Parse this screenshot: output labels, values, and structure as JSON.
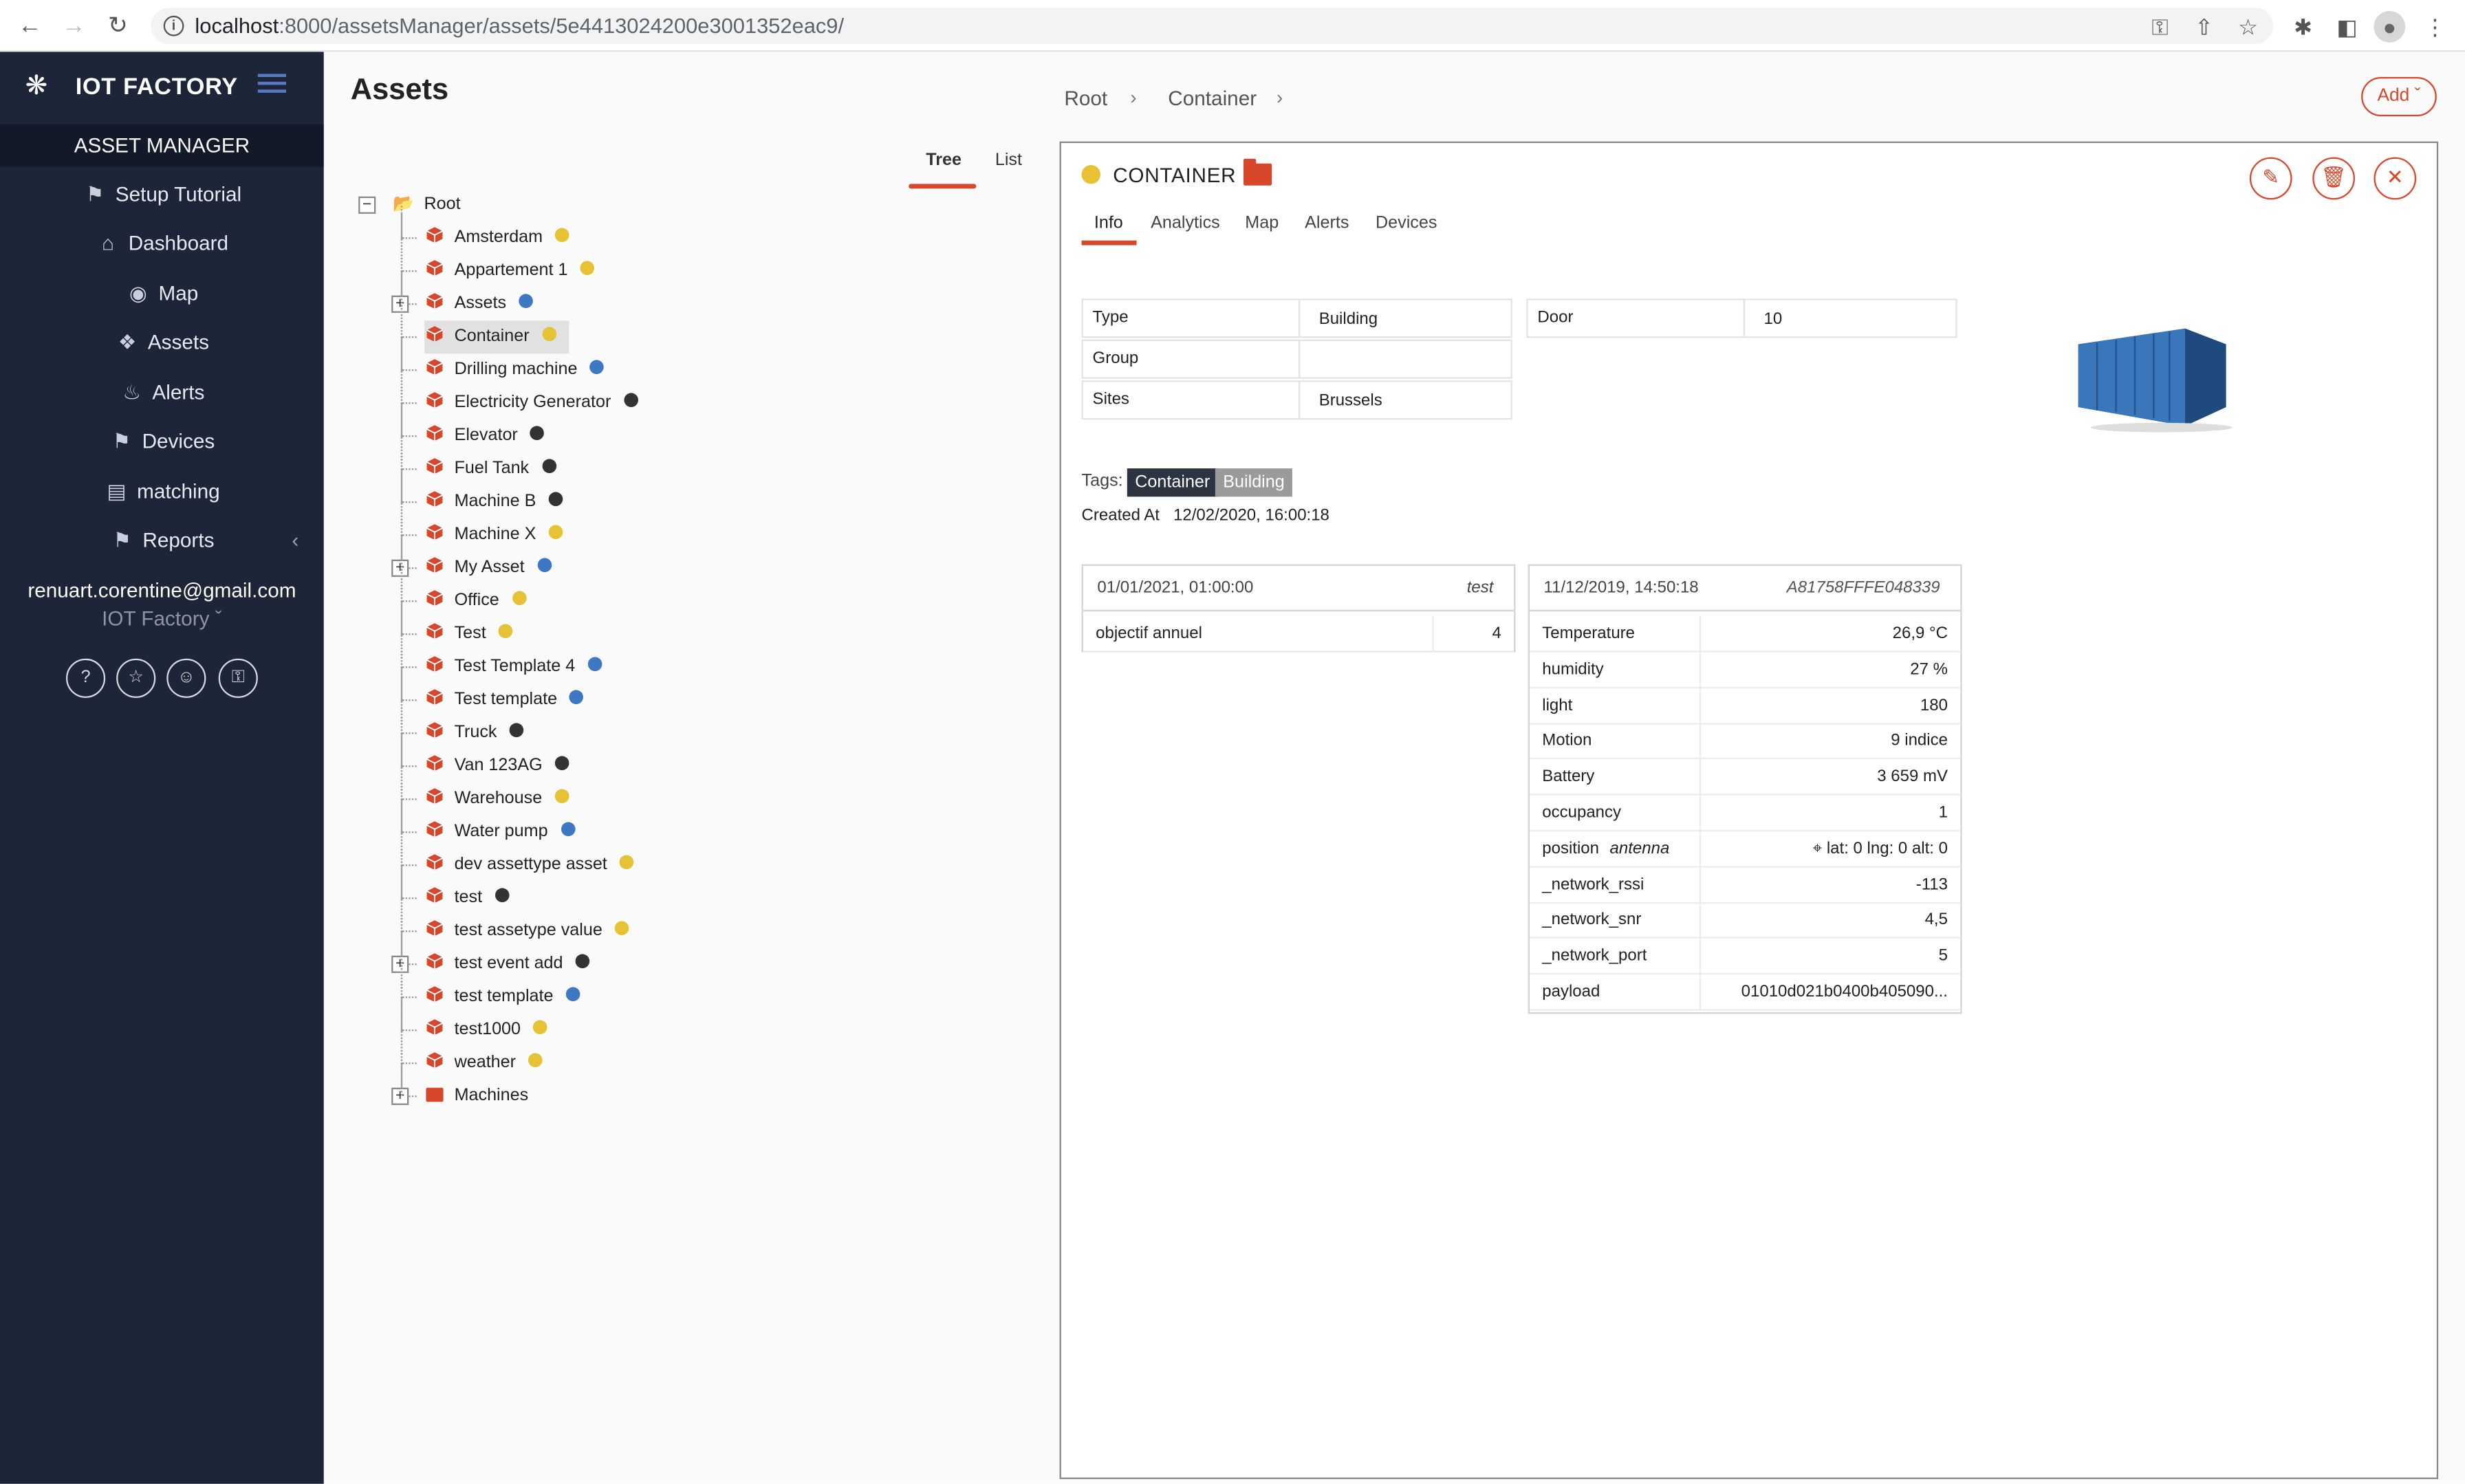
{
  "browser": {
    "url_host": "localhost",
    "url_path": ":8000/assetsManager/assets/5e4413024200e3001352eac9/"
  },
  "sidebar": {
    "brand": "IOT FACTORY",
    "section": "ASSET MANAGER",
    "items": [
      {
        "label": "Setup Tutorial",
        "icon": "tag-icon"
      },
      {
        "label": "Dashboard",
        "icon": "home-icon"
      },
      {
        "label": "Map",
        "icon": "pin-icon"
      },
      {
        "label": "Assets",
        "icon": "boxes-icon"
      },
      {
        "label": "Alerts",
        "icon": "bell-icon"
      },
      {
        "label": "Devices",
        "icon": "tag-icon"
      },
      {
        "label": "matching",
        "icon": "briefcase-icon"
      },
      {
        "label": "Reports",
        "icon": "tag-icon"
      }
    ],
    "user_email": "renuart.corentine@gmail.com",
    "org": "IOT Factory"
  },
  "header": {
    "title": "Assets",
    "breadcrumb": [
      "Root",
      "Container"
    ],
    "add_label": "Add"
  },
  "view_tabs": [
    "Tree",
    "List"
  ],
  "tree": {
    "root": "Root",
    "items": [
      {
        "label": "Amsterdam",
        "color": "#e6c234",
        "expand": false
      },
      {
        "label": "Appartement 1",
        "color": "#e6c234",
        "expand": false
      },
      {
        "label": "Assets",
        "color": "#3e78c2",
        "expand": true
      },
      {
        "label": "Container",
        "color": "#e6c234",
        "expand": false,
        "selected": true
      },
      {
        "label": "Drilling machine",
        "color": "#3e78c2",
        "expand": false
      },
      {
        "label": "Electricity Generator",
        "color": "#333333",
        "expand": false
      },
      {
        "label": "Elevator",
        "color": "#333333",
        "expand": false
      },
      {
        "label": "Fuel Tank",
        "color": "#333333",
        "expand": false
      },
      {
        "label": "Machine B",
        "color": "#333333",
        "expand": false
      },
      {
        "label": "Machine X",
        "color": "#e6c234",
        "expand": false
      },
      {
        "label": "My Asset",
        "color": "#3e78c2",
        "expand": true
      },
      {
        "label": "Office",
        "color": "#e6c234",
        "expand": false
      },
      {
        "label": "Test",
        "color": "#e6c234",
        "expand": false
      },
      {
        "label": "Test Template 4",
        "color": "#3e78c2",
        "expand": false
      },
      {
        "label": "Test template",
        "color": "#3e78c2",
        "expand": false
      },
      {
        "label": "Truck",
        "color": "#333333",
        "expand": false
      },
      {
        "label": "Van 123AG",
        "color": "#333333",
        "expand": false
      },
      {
        "label": "Warehouse",
        "color": "#e6c234",
        "expand": false
      },
      {
        "label": "Water pump",
        "color": "#3e78c2",
        "expand": false
      },
      {
        "label": "dev assettype asset",
        "color": "#e6c234",
        "expand": false
      },
      {
        "label": "test",
        "color": "#333333",
        "expand": false
      },
      {
        "label": "test assetype value",
        "color": "#e6c234",
        "expand": false
      },
      {
        "label": "test event add",
        "color": "#333333",
        "expand": true
      },
      {
        "label": "test template",
        "color": "#3e78c2",
        "expand": false
      },
      {
        "label": "test1000",
        "color": "#e6c234",
        "expand": false
      },
      {
        "label": "weather",
        "color": "#e6c234",
        "expand": false
      },
      {
        "label": "Machines",
        "color": null,
        "expand": true,
        "folder": true
      }
    ]
  },
  "detail": {
    "title": "CONTAINER",
    "tabs": [
      "Info",
      "Analytics",
      "Map",
      "Alerts",
      "Devices"
    ],
    "props": [
      {
        "key": "Type",
        "value": "Building"
      },
      {
        "key": "Group",
        "value": ""
      },
      {
        "key": "Sites",
        "value": "Brussels"
      }
    ],
    "door": {
      "key": "Door",
      "value": "10"
    },
    "tags_label": "Tags:",
    "tags": [
      "Container",
      "Building"
    ],
    "created_label": "Created At",
    "created_value": "12/02/2020, 16:00:18",
    "goal_card": {
      "date": "01/01/2021, 01:00:00",
      "name": "test",
      "row_key": "objectif annuel",
      "row_value": "4"
    },
    "device_card": {
      "date": "11/12/2019, 14:50:18",
      "device_id": "A81758FFFE048339",
      "rows": [
        {
          "key": "Temperature",
          "value": "26,9 °C"
        },
        {
          "key": "humidity",
          "value": "27 %"
        },
        {
          "key": "light",
          "value": "180"
        },
        {
          "key": "Motion",
          "value": "9 indice"
        },
        {
          "key": "Battery",
          "value": "3 659 mV"
        },
        {
          "key": "occupancy",
          "value": "1"
        },
        {
          "key": "position",
          "sub": "antenna",
          "value": "lat: 0 lng: 0 alt: 0"
        },
        {
          "key": "_network_rssi",
          "value": "-113"
        },
        {
          "key": "_network_snr",
          "value": "4,5"
        },
        {
          "key": "_network_port",
          "value": "5"
        },
        {
          "key": "payload",
          "value": "01010d021b0400b405090..."
        }
      ]
    }
  }
}
